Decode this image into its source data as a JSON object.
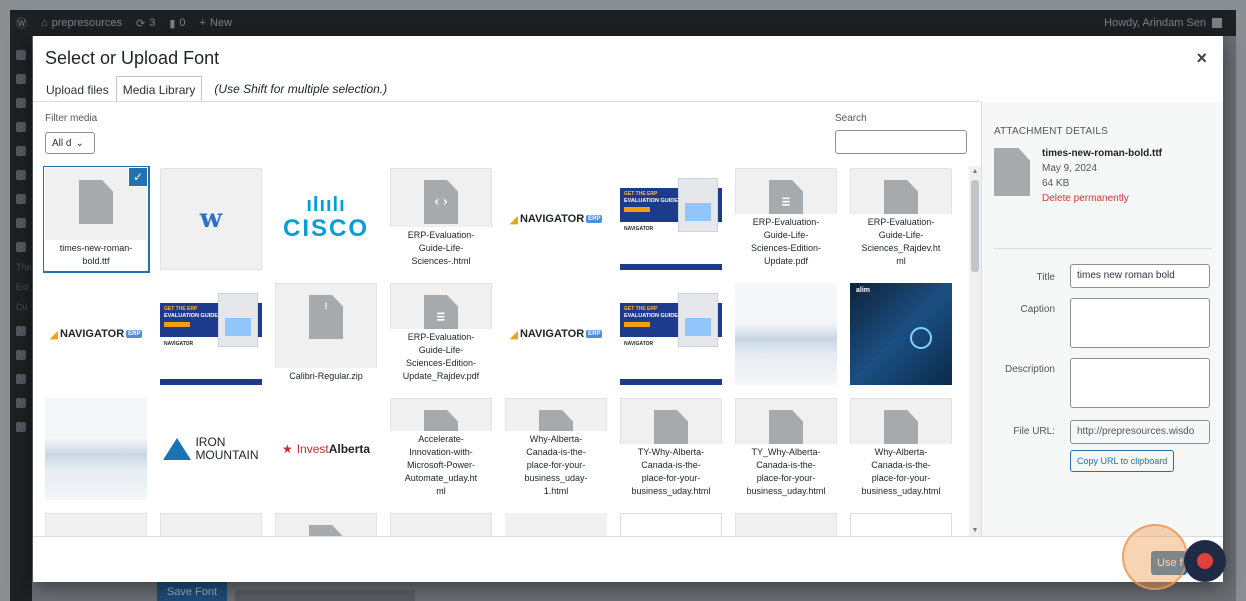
{
  "adminbar": {
    "site_name": "prepresources",
    "updates_count": "3",
    "comments_count": "0",
    "new_label": "New",
    "howdy": "Howdy, Arindam Sen"
  },
  "sidebar": {
    "text_items": [
      "The",
      "Edi",
      "Cu"
    ]
  },
  "underlying": {
    "save_font": "Save Font"
  },
  "modal": {
    "title": "Select or Upload Font",
    "close_symbol": "×",
    "tabs": [
      {
        "label": "Upload files",
        "active": false
      },
      {
        "label": "Media Library",
        "active": true
      }
    ],
    "tab_hint": "(Use Shift for multiple selection.)",
    "filter_label": "Filter media",
    "filter_value": "All d",
    "search_label": "Search",
    "search_value": ""
  },
  "attachments": [
    {
      "kind": "file",
      "filename": "times-new-roman-bold.ttf",
      "display": "times-new-roman-\nbold.ttf",
      "selected": true
    },
    {
      "kind": "logo-w",
      "mark": "w"
    },
    {
      "kind": "logo-cisco",
      "bars": "ılıılı",
      "word": "CISCO"
    },
    {
      "kind": "file-code",
      "display": "ERP-Evaluation-\nGuide-Life-\nSciences-.html"
    },
    {
      "kind": "logo-nav",
      "word": "NAVIGATOR",
      "tag": "ERP"
    },
    {
      "kind": "erp-guide",
      "t1": "GET THE ERP",
      "t2": "EVALUATION GUIDE",
      "nav": "NAVIGATOR"
    },
    {
      "kind": "file-doc",
      "display": "ERP-Evaluation-\nGuide-Life-\nSciences-Edition-\nUpdate.pdf"
    },
    {
      "kind": "file",
      "display": "ERP-Evaluation-\nGuide-Life-\nSciences_Rajdev.ht\nml"
    },
    {
      "kind": "logo-nav",
      "word": "NAVIGATOR",
      "tag": "ERP"
    },
    {
      "kind": "erp-guide",
      "t1": "GET THE ERP",
      "t2": "EVALUATION GUIDE",
      "nav": "NAVIGATOR"
    },
    {
      "kind": "file-zip",
      "display": "Calibri-Regular.zip"
    },
    {
      "kind": "file-doc",
      "display": "ERP-Evaluation-\nGuide-Life-\nSciences-Edition-\nUpdate_Rajdev.pdf"
    },
    {
      "kind": "logo-nav",
      "word": "NAVIGATOR",
      "tag": "ERP"
    },
    {
      "kind": "erp-guide",
      "t1": "GET THE ERP",
      "t2": "EVALUATION GUIDE",
      "nav": "NAVIGATOR"
    },
    {
      "kind": "mountains"
    },
    {
      "kind": "iot",
      "brand": "alim"
    },
    {
      "kind": "mountains"
    },
    {
      "kind": "logo-iron",
      "line1": "IRON",
      "line2": "MOUNTAIN"
    },
    {
      "kind": "logo-alberta",
      "invest": "Invest",
      "alberta": "Alberta"
    },
    {
      "kind": "file",
      "display": "Accelerate-\nInnovation-with-\nMicrosoft-Power-\nAutomate_uday.ht\nml"
    },
    {
      "kind": "file",
      "display": "Why-Alberta-\nCanada-is-the-\nplace-for-your-\nbusiness_uday-\n1.html"
    },
    {
      "kind": "file",
      "display": "TY-Why-Alberta-\nCanada-is-the-\nplace-for-your-\nbusiness_uday.html"
    },
    {
      "kind": "file",
      "display": "TY_Why-Alberta-\nCanada-is-the-\nplace-for-your-\nbusiness_uday.html"
    },
    {
      "kind": "file",
      "display": "Why-Alberta-\nCanada-is-the-\nplace-for-your-\nbusiness_uday.html"
    },
    {
      "kind": "blank"
    },
    {
      "kind": "blank"
    },
    {
      "kind": "file-doc",
      "display": ""
    },
    {
      "kind": "blank"
    },
    {
      "kind": "field"
    },
    {
      "kind": "white"
    },
    {
      "kind": "blank"
    },
    {
      "kind": "white"
    }
  ],
  "details": {
    "heading": "ATTACHMENT DETAILS",
    "filename": "times-new-roman-bold.ttf",
    "date": "May 9, 2024",
    "size": "64 KB",
    "delete_label": "Delete permanently",
    "title_label": "Title",
    "title_value": "times new roman bold",
    "caption_label": "Caption",
    "caption_value": "",
    "description_label": "Description",
    "description_value": "",
    "file_url_label": "File URL:",
    "file_url_value": "http://prepresources.wisdo",
    "copy_label": "Copy URL to clipboard"
  },
  "footer": {
    "use_label": "Use f"
  },
  "colors": {
    "accent": "#2271b1",
    "delete": "#d63638",
    "record": "#e0413c",
    "highlight": "#f0a05a"
  }
}
